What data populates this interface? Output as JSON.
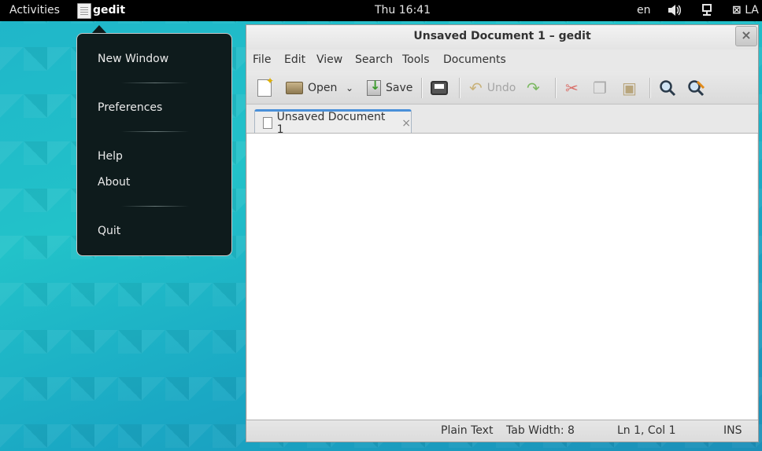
{
  "topbar": {
    "activities": "Activities",
    "app_name": "gedit",
    "clock": "Thu 16:41",
    "language": "en",
    "user": "LA"
  },
  "app_menu": {
    "items": [
      "New Window",
      "Preferences",
      "Help",
      "About",
      "Quit"
    ]
  },
  "window": {
    "title": "Unsaved Document 1 – gedit",
    "close_glyph": "×"
  },
  "menubar": [
    "File",
    "Edit",
    "View",
    "Search",
    "Tools",
    "Documents"
  ],
  "toolbar": {
    "open_label": "Open",
    "save_label": "Save",
    "undo_label": "Undo"
  },
  "tabs": [
    {
      "label": "Unsaved Document 1",
      "close_glyph": "×"
    }
  ],
  "statusbar": {
    "language": "Plain Text",
    "tab_width": "Tab Width: 8",
    "position": "Ln 1, Col 1",
    "mode": "INS"
  },
  "colors": {
    "topbar_bg": "#000000",
    "popup_bg": "#0e1b1c",
    "tab_accent": "#4a90d9",
    "cut_icon": "#c0392b",
    "redo_icon": "#5aa02c"
  },
  "icons": [
    "app-icon",
    "volume-icon",
    "network-icon",
    "user-icon",
    "new-document-icon",
    "open-folder-icon",
    "save-icon",
    "print-icon",
    "undo-icon",
    "redo-icon",
    "cut-icon",
    "copy-icon",
    "paste-icon",
    "search-icon",
    "replace-icon",
    "document-icon"
  ]
}
